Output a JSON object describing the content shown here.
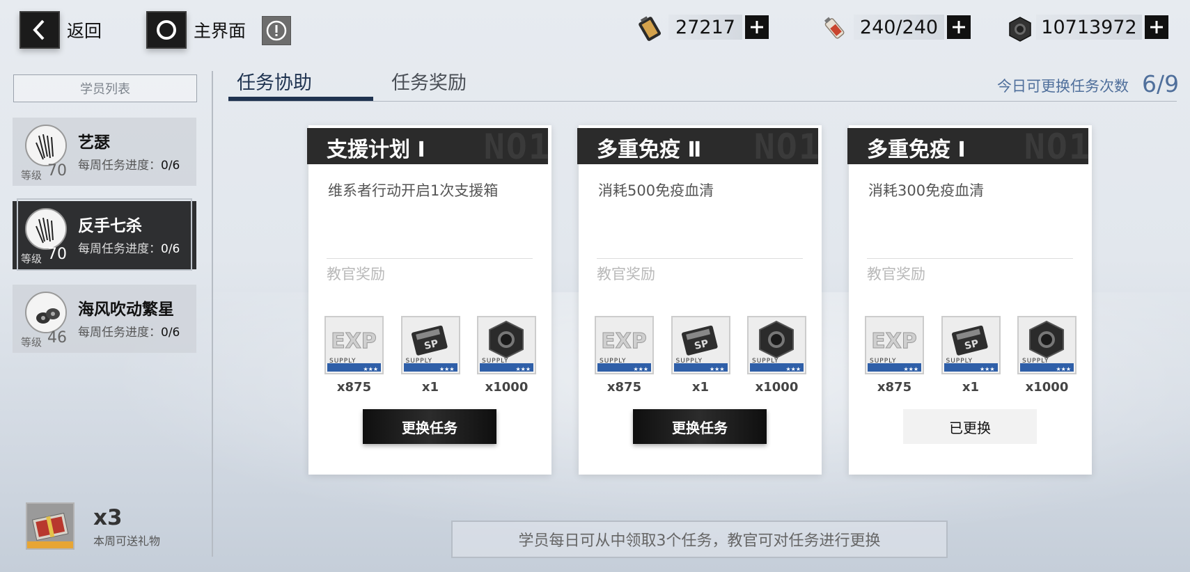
{
  "top": {
    "back_label": "返回",
    "home_label": "主界面"
  },
  "resources": [
    {
      "icon": "battery-fuel-icon",
      "value": "27217"
    },
    {
      "icon": "syringe-stamina-icon",
      "value": "240/240"
    },
    {
      "icon": "hex-nut-icon",
      "value": "10713972"
    }
  ],
  "sidebar": {
    "title": "学员列表",
    "students": [
      {
        "name": "艺瑟",
        "level_label": "等级",
        "level": "70",
        "progress_label": "每周任务进度：",
        "progress": "0/6"
      },
      {
        "name": "反手七杀",
        "level_label": "等级",
        "level": "70",
        "progress_label": "每周任务进度：",
        "progress": "0/6"
      },
      {
        "name": "海风吹动繁星",
        "level_label": "等级",
        "level": "46",
        "progress_label": "每周任务进度：",
        "progress": "0/6"
      }
    ],
    "gift": {
      "count": "x3",
      "label": "本周可送礼物"
    }
  },
  "tabs": [
    {
      "label": "任务协助",
      "active": true
    },
    {
      "label": "任务奖励",
      "active": false
    }
  ],
  "swap": {
    "label": "今日可更换任务次数",
    "value": "6/9"
  },
  "cards": [
    {
      "title": "支援计划 Ⅰ",
      "watermark": "NO1",
      "desc": "维系者行动开启1次支援箱",
      "reward_label": "教官奖励",
      "rewards": [
        {
          "icon": "exp-supply-icon",
          "qty": "x875"
        },
        {
          "icon": "sp-card-icon",
          "qty": "x1"
        },
        {
          "icon": "hex-nut-icon",
          "qty": "x1000"
        }
      ],
      "button": "更换任务",
      "button_state": "active"
    },
    {
      "title": "多重免疫 Ⅱ",
      "watermark": "NO1",
      "desc": "消耗500免疫血清",
      "reward_label": "教官奖励",
      "rewards": [
        {
          "icon": "exp-supply-icon",
          "qty": "x875"
        },
        {
          "icon": "sp-card-icon",
          "qty": "x1"
        },
        {
          "icon": "hex-nut-icon",
          "qty": "x1000"
        }
      ],
      "button": "更换任务",
      "button_state": "active"
    },
    {
      "title": "多重免疫 Ⅰ",
      "watermark": "NO1",
      "desc": "消耗300免疫血清",
      "reward_label": "教官奖励",
      "rewards": [
        {
          "icon": "exp-supply-icon",
          "qty": "x875"
        },
        {
          "icon": "sp-card-icon",
          "qty": "x1"
        },
        {
          "icon": "hex-nut-icon",
          "qty": "x1000"
        }
      ],
      "button": "已更换",
      "button_state": "done"
    }
  ],
  "item_supply_text": "SUPPLY",
  "bottom_note": "学员每日可从中领取3个任务，教官可对任务进行更换",
  "colors": {
    "accent": "#1f3350",
    "swap_text": "#4f6f9b",
    "dark_panel": "#2b2b2b"
  }
}
